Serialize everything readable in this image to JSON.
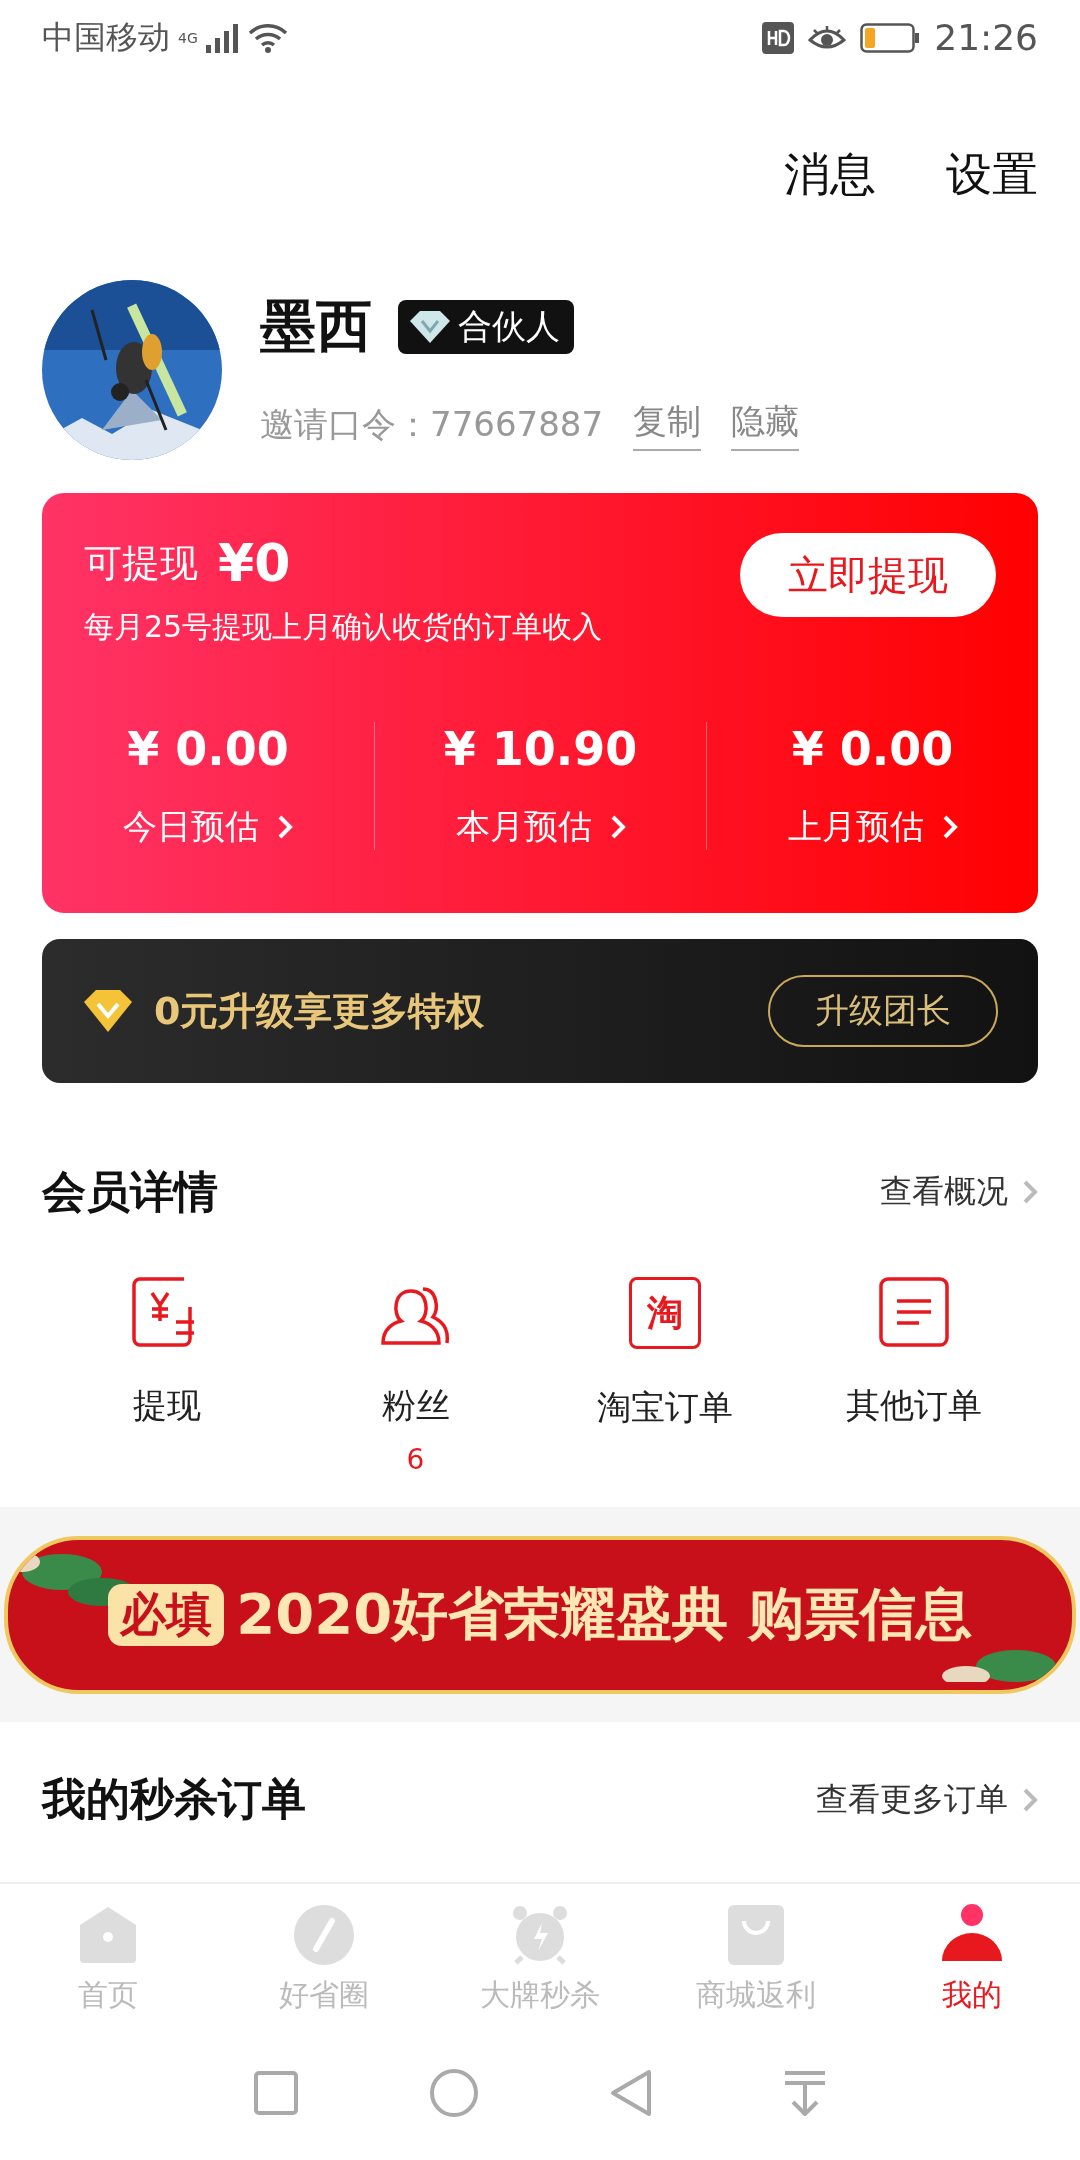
{
  "status_bar": {
    "carrier": "中国移动",
    "network": "4G",
    "time": "21:26"
  },
  "header_actions": [
    "消息",
    "设置"
  ],
  "profile": {
    "name": "墨西",
    "badge": "合伙人",
    "invite": "邀请口令：77667887",
    "links": [
      "复制",
      "隐藏"
    ]
  },
  "wallet": {
    "label": "可提现",
    "amount": "¥0",
    "note": "每月25号提现上月确认收货的订单收入",
    "button": "立即提现",
    "stats": [
      {
        "value": "¥ 0.00",
        "label": "今日预估"
      },
      {
        "value": "¥ 10.90",
        "label": "本月预估"
      },
      {
        "value": "¥ 0.00",
        "label": "上月预估"
      }
    ]
  },
  "upgrade": {
    "text": "0元升级享更多特权",
    "button": "升级团长"
  },
  "member": {
    "title": "会员详情",
    "more": "查看概况",
    "items": [
      {
        "kind": "withdraw",
        "label": "提现"
      },
      {
        "kind": "fans",
        "label": "粉丝",
        "count": "6"
      },
      {
        "kind": "taobao",
        "glyph": "淘",
        "label": "淘宝订单"
      },
      {
        "kind": "orders",
        "label": "其他订单"
      }
    ]
  },
  "banner": {
    "tag": "必填",
    "text": "2020好省荣耀盛典 购票信息"
  },
  "flash_orders": {
    "title": "我的秒杀订单",
    "more": "查看更多订单"
  },
  "tabs": [
    {
      "kind": "home",
      "label": "首页",
      "selected": false
    },
    {
      "kind": "circle",
      "label": "好省圈",
      "selected": false
    },
    {
      "kind": "alarm",
      "label": "大牌秒杀",
      "selected": false
    },
    {
      "kind": "bag",
      "label": "商城返利",
      "selected": false
    },
    {
      "kind": "me",
      "label": "我的",
      "selected": true
    }
  ]
}
